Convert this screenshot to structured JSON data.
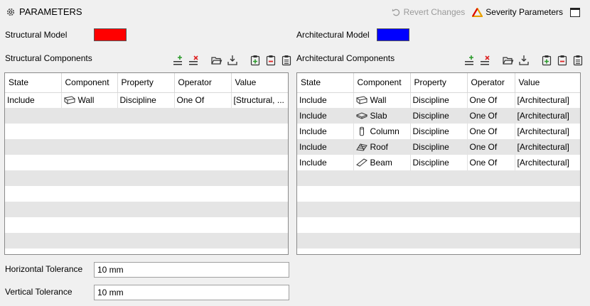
{
  "header": {
    "title": "PARAMETERS",
    "revert_label": "Revert Changes",
    "severity_label": "Severity Parameters"
  },
  "structural": {
    "model_label": "Structural Model",
    "model_color": "#ff0000",
    "components_label": "Structural Components",
    "columns": [
      "State",
      "Component",
      "Property",
      "Operator",
      "Value"
    ],
    "rows": [
      {
        "state": "Include",
        "component": "Wall",
        "icon": "wall-icon",
        "property": "Discipline",
        "operator": "One Of",
        "value": "[Structural, ..."
      }
    ]
  },
  "architectural": {
    "model_label": "Architectural Model",
    "model_color": "#0000ff",
    "components_label": "Architectural Components",
    "columns": [
      "State",
      "Component",
      "Property",
      "Operator",
      "Value"
    ],
    "rows": [
      {
        "state": "Include",
        "component": "Wall",
        "icon": "wall-icon",
        "property": "Discipline",
        "operator": "One Of",
        "value": "[Architectural]"
      },
      {
        "state": "Include",
        "component": "Slab",
        "icon": "slab-icon",
        "property": "Discipline",
        "operator": "One Of",
        "value": "[Architectural]"
      },
      {
        "state": "Include",
        "component": "Column",
        "icon": "column-icon",
        "property": "Discipline",
        "operator": "One Of",
        "value": "[Architectural]"
      },
      {
        "state": "Include",
        "component": "Roof",
        "icon": "roof-icon",
        "property": "Discipline",
        "operator": "One Of",
        "value": "[Architectural]"
      },
      {
        "state": "Include",
        "component": "Beam",
        "icon": "beam-icon",
        "property": "Discipline",
        "operator": "One Of",
        "value": "[Architectural]"
      }
    ]
  },
  "tolerances": {
    "horizontal_label": "Horizontal Tolerance",
    "horizontal_value": "10 mm",
    "vertical_label": "Vertical Tolerance",
    "vertical_value": "10 mm"
  }
}
